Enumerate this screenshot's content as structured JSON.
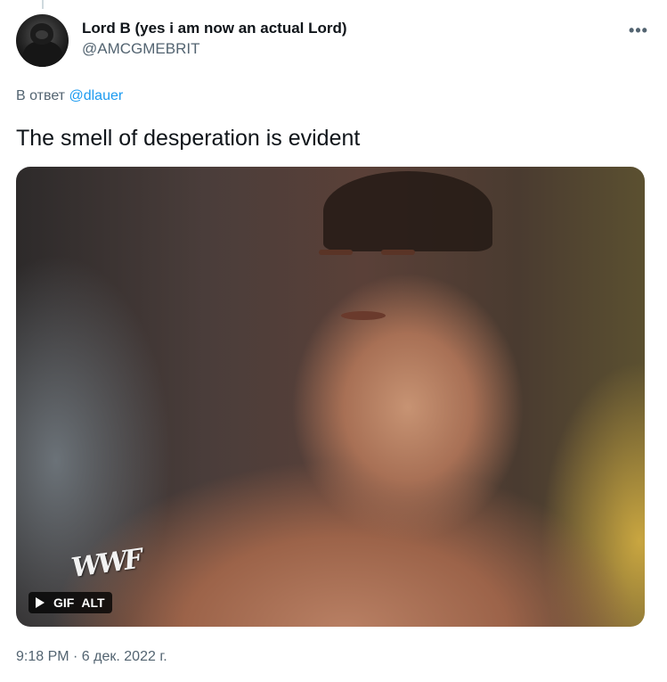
{
  "tweet": {
    "author": {
      "display_name": "Lord B (yes i am now an actual Lord)",
      "handle": "@AMCGMEBRIT"
    },
    "more_icon": "more-horizontal-icon",
    "reply_prefix": "В ответ",
    "reply_to": "@dlauer",
    "text": "The smell of desperation is evident",
    "media": {
      "type": "gif",
      "gif_label": "GIF",
      "alt_label": "ALT",
      "play_icon": "play-icon",
      "watermark": "WWF"
    },
    "timestamp": "9:18 PM · 6 дек. 2022 г."
  },
  "colors": {
    "text_primary": "#0f1419",
    "text_secondary": "#536471",
    "accent": "#1d9bf0"
  }
}
